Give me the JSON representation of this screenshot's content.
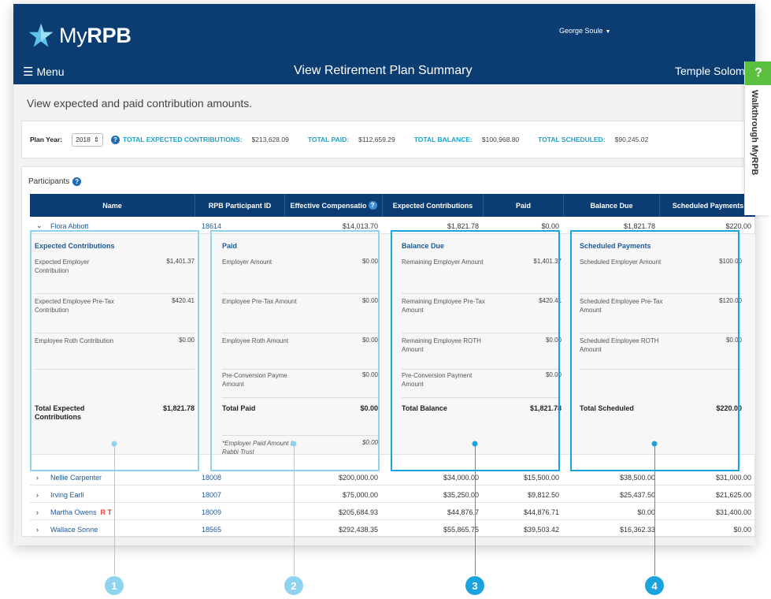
{
  "app": {
    "brand_prefix": "My",
    "brand_name": "RPB",
    "user_name": "George Soule",
    "menu_label": "Menu",
    "page_title": "View Retirement Plan Summary",
    "org_name": "Temple Solom"
  },
  "intro": "View expected and paid contribution amounts.",
  "plan_bar": {
    "year_label": "Plan Year:",
    "year_value": "2018",
    "totals": [
      {
        "label": "TOTAL EXPECTED CONTRIBUTIONS:",
        "value": "$213,628.09"
      },
      {
        "label": "TOTAL PAID:",
        "value": "$112,659.29"
      },
      {
        "label": "TOTAL BALANCE:",
        "value": "$100,968.80"
      },
      {
        "label": "TOTAL SCHEDULED:",
        "value": "$90,245.02"
      }
    ]
  },
  "participants": {
    "heading": "Participants",
    "columns": [
      "Name",
      "RPB Participant ID",
      "Effective Compensatio",
      "Expected Contributions",
      "Paid",
      "Balance Due",
      "Scheduled Payments"
    ],
    "expanded_row": {
      "name": "Flora Abbott",
      "id": "18614",
      "comp": "$14,013.70",
      "expected": "$1,821.78",
      "paid": "$0.00",
      "balance": "$1,821.78",
      "scheduled": "$220.00"
    },
    "rows": [
      {
        "name": "Nellie Carpenter",
        "tag": "",
        "id": "18008",
        "comp": "$200,000.00",
        "expected": "$34,000.00",
        "paid": "$15,500.00",
        "balance": "$38,500.00",
        "scheduled": "$31,000.00"
      },
      {
        "name": "Irving Earll",
        "tag": "",
        "id": "18007",
        "comp": "$75,000.00",
        "expected": "$35,250.00",
        "paid": "$9,812.50",
        "balance": "$25,437.50",
        "scheduled": "$21,625.00"
      },
      {
        "name": "Martha Owens",
        "tag": "R T",
        "id": "18009",
        "comp": "$205,684.93",
        "expected": "$44,876.7",
        "paid": "$44,876.71",
        "balance": "$0.00",
        "scheduled": "$31,400.00"
      },
      {
        "name": "Wallace Sonne",
        "tag": "",
        "id": "18565",
        "comp": "$292,438.35",
        "expected": "$55,865.75",
        "paid": "$39,503.42",
        "balance": "$16,362.33",
        "scheduled": "$0.00"
      }
    ]
  },
  "detail": {
    "expected": {
      "title": "Expected Contributions",
      "items": [
        {
          "label": "Expected Employer Contribution",
          "value": "$1,401.37"
        },
        {
          "label": "Expected Employee Pre-Tax Contribution",
          "value": "$420.41"
        },
        {
          "label": "Employee Roth Contribution",
          "value": "$0.00"
        }
      ],
      "total_label": "Total Expected Contributions",
      "total_value": "$1,821.78"
    },
    "paid": {
      "title": "Paid",
      "items": [
        {
          "label": "Employer Amount",
          "value": "$0.00"
        },
        {
          "label": "Employee Pre-Tax Amount",
          "value": "$0.00"
        },
        {
          "label": "Employee Roth Amount",
          "value": "$0.00"
        },
        {
          "label": "Pre-Conversion Payme Amount",
          "value": "$0.00"
        }
      ],
      "total_label": "Total Paid",
      "total_value": "$0.00",
      "note_label": "*Employer Paid Amount in Rabbi Trust",
      "note_value": "$0.00"
    },
    "balance": {
      "title": "Balance Due",
      "items": [
        {
          "label": "Remaining Employer Amount",
          "value": "$1,401.37"
        },
        {
          "label": "Remaining Employee Pre-Tax Amount",
          "value": "$420.41"
        },
        {
          "label": "Remaining Employee ROTH Amount",
          "value": "$0.00"
        },
        {
          "label": "Pre-Conversion Payment Amount",
          "value": "$0.00"
        }
      ],
      "total_label": "Total Balance",
      "total_value": "$1,821.78"
    },
    "scheduled": {
      "title": "Scheduled Payments",
      "items": [
        {
          "label": "Scheduled Employer Amount",
          "value": "$100.00"
        },
        {
          "label": "Scheduled Employee Pre-Tax Amount",
          "value": "$120.00"
        },
        {
          "label": "Scheduled Employee ROTH Amount",
          "value": "$0.00"
        }
      ],
      "total_label": "Total Scheduled",
      "total_value": "$220.00"
    }
  },
  "callouts": [
    "1",
    "2",
    "3",
    "4"
  ],
  "walkthrough": {
    "label": "Walkthrough MyRPB",
    "icon": "?"
  },
  "colors": {
    "navy": "#0b3d73",
    "teal": "#1aa3c9",
    "callout_light": "#8fd3ee",
    "callout_dark": "#1aa3dc",
    "walk_green": "#5bbf3f"
  }
}
